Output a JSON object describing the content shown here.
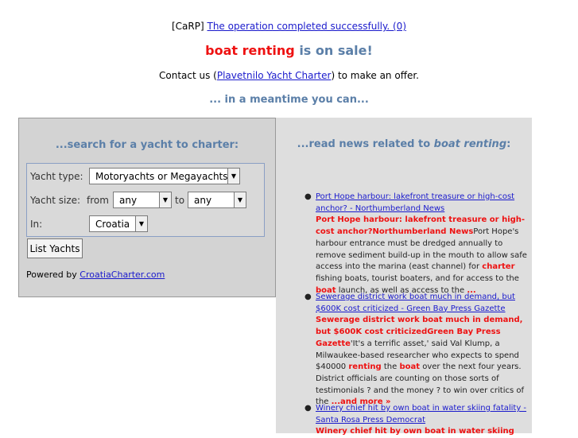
{
  "top": {
    "carp_prefix": "[CaRP]",
    "carp_link": "The operation completed successfully. (0)",
    "headline_red": "boat renting",
    "headline_blue": " is on sale!",
    "contact_prefix": "Contact us (",
    "contact_link": "Plavetnilo Yacht Charter",
    "contact_suffix": ") to make an offer.",
    "meantime": "... in a meantime you can..."
  },
  "search": {
    "title": "...search for a yacht to charter:",
    "yacht_type_label": "Yacht type:",
    "yacht_type_value": "Motoryachts or Megayachts",
    "yacht_size_label": "Yacht size:",
    "from_label": "from",
    "from_value": "any",
    "to_label": "to",
    "to_value": "any",
    "in_label": "In:",
    "in_value": "Croatia",
    "list_button": "List Yachts",
    "powered_prefix": "Powered by ",
    "powered_link": "CroatiaCharter.com"
  },
  "news": {
    "title_prefix": "...read news related to ",
    "title_topic": "boat renting",
    "title_suffix": ":",
    "items": [
      {
        "link": "Port Hope harbour: lakefront treasure or high-cost anchor? - Northumberland News",
        "bold": "Port Hope harbour: lakefront treasure or high-cost anchor?Northumberland News",
        "t1": "Port Hope's harbour entrance must be dredged annually to remove sediment build-up in the mouth to allow safe access into the marina (east channel) for ",
        "k1": "charter",
        "t2": " fishing boats, tourist boaters, and for access to the ",
        "k2": "boat",
        "t3": " launch, as well as access to the ",
        "more": "..."
      },
      {
        "link": "Sewerage district work boat much in demand, but $600K cost criticized - Green Bay Press Gazette",
        "bold": "Sewerage district work boat much in demand, but $600K cost criticizedGreen Bay Press Gazette",
        "t1": "'It's a terrific asset,' said Val Klump, a Milwaukee-based researcher who expects to spend $40000 ",
        "k1": "renting",
        "t2": " the ",
        "k2": "boat",
        "t3": " over the next four years. District officials are counting on those sorts of testimonials ? and the money ? to win over critics of the ",
        "more": "...and more »"
      },
      {
        "link": "Winery chief hit by own boat in water skiing fatality - Santa Rosa Press Democrat",
        "bold": "Winery chief hit by own boat in water skiing"
      }
    ]
  }
}
